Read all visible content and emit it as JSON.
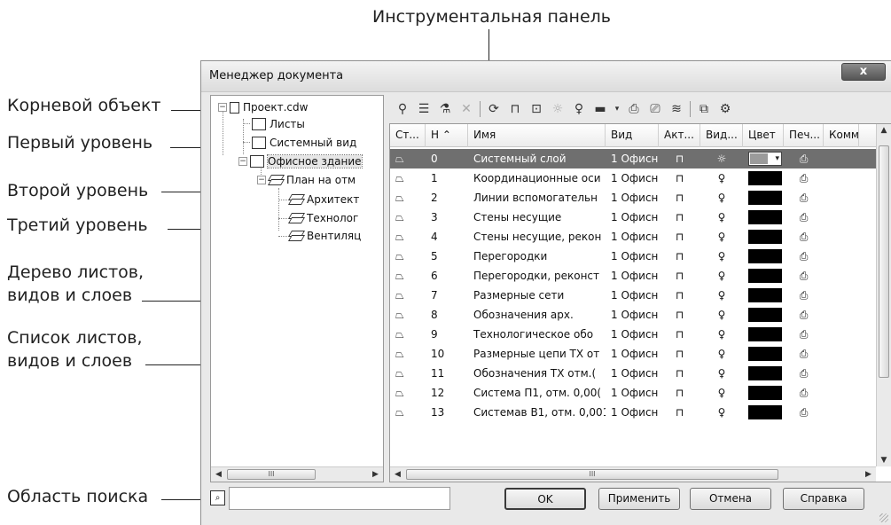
{
  "callouts": {
    "toolbar": "Инструментальная панель",
    "root": "Корневой объект",
    "level1": "Первый уровень",
    "level2": "Второй уровень",
    "level3": "Третий уровень",
    "tree_desc_1": "Дерево листов,",
    "tree_desc_2": "видов и слоев",
    "list_desc_1": "Список листов,",
    "list_desc_2": "видов и слоев",
    "search_area": "Область поиска"
  },
  "window": {
    "title": "Менеджер документа",
    "close_label": "x"
  },
  "tree": {
    "root": "Проект.cdw",
    "sheets": "Листы",
    "system_view": "Системный вид",
    "office_view": "Офисное здание",
    "plan": "План на отм",
    "layer1": "Архитект",
    "layer2": "Технолог",
    "layer3": "Вентиляц",
    "scroll_thumb": "III"
  },
  "grid": {
    "headers": [
      "Ст...",
      "Н ⌃",
      "Имя",
      "Вид",
      "Акт...",
      "Вид...",
      "Цвет",
      "Печ...",
      "Комм"
    ],
    "rows": [
      {
        "n": "0",
        "name": "Системный слой",
        "view": "1 Офисн"
      },
      {
        "n": "1",
        "name": "Координационные оси",
        "view": "1 Офисн"
      },
      {
        "n": "2",
        "name": "Линии вспомогательн",
        "view": "1 Офисн"
      },
      {
        "n": "3",
        "name": "Стены несущие",
        "view": "1 Офисн"
      },
      {
        "n": "4",
        "name": "Стены несущие, рекон",
        "view": "1 Офисн"
      },
      {
        "n": "5",
        "name": "Перегородки",
        "view": "1 Офисн"
      },
      {
        "n": "6",
        "name": "Перегородки, реконст",
        "view": "1 Офисн"
      },
      {
        "n": "7",
        "name": "Размерные сети",
        "view": "1 Офисн"
      },
      {
        "n": "8",
        "name": "Обозначения арх.",
        "view": "1 Офисн"
      },
      {
        "n": "9",
        "name": "Технологическое обо",
        "view": "1 Офисн"
      },
      {
        "n": "10",
        "name": "Размерные цепи ТХ от",
        "view": "1 Офисн"
      },
      {
        "n": "11",
        "name": "Обозначения ТХ отм.(",
        "view": "1 Офисн"
      },
      {
        "n": "12",
        "name": "Система П1, отм. 0,00(",
        "view": "1 Офисн"
      },
      {
        "n": "13",
        "name": "Системав В1, отм. 0,001",
        "view": "1 Офисн"
      }
    ],
    "scroll_thumb": "III"
  },
  "buttons": {
    "ok": "OK",
    "apply": "Применить",
    "cancel": "Отмена",
    "help": "Справка"
  },
  "search": {
    "placeholder": ""
  }
}
